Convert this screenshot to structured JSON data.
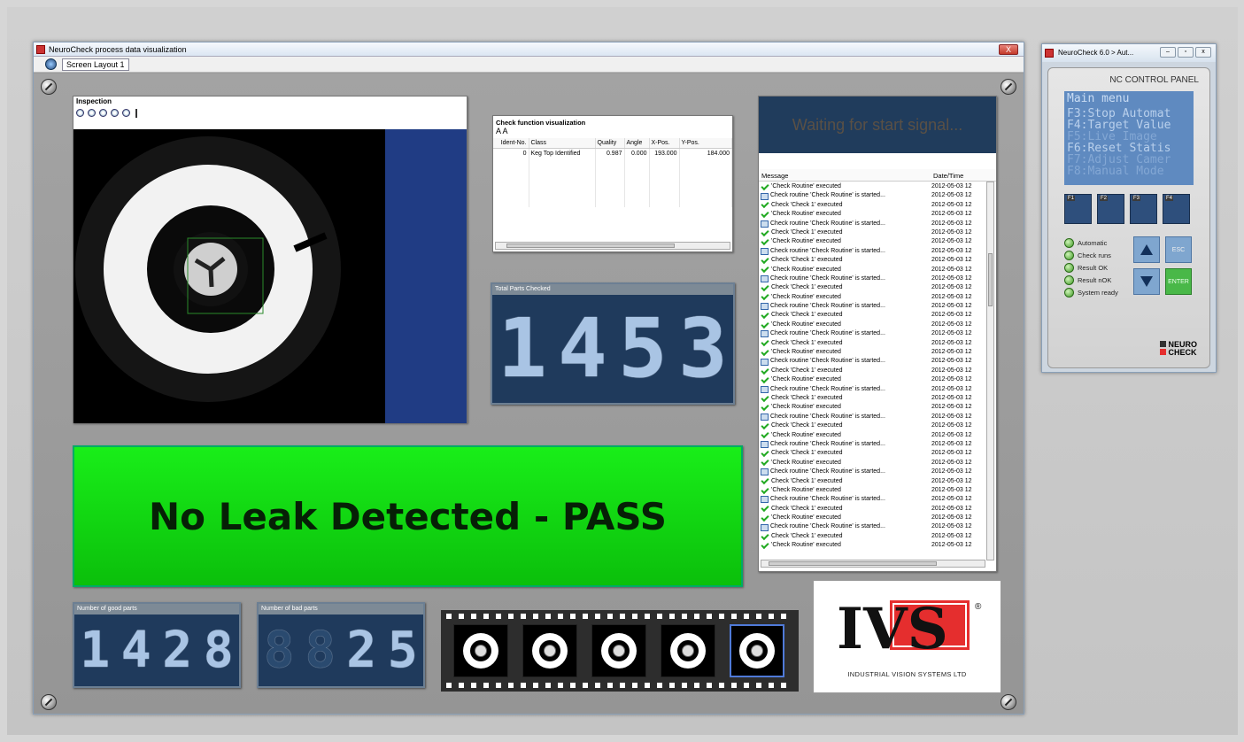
{
  "window": {
    "title": "NeuroCheck process data visualization",
    "close_label": "X"
  },
  "toolbar": {
    "layout_label": "Screen Layout 1"
  },
  "inspection": {
    "title": "Inspection"
  },
  "check_function": {
    "title": "Check function visualization",
    "font_controls": "A A",
    "columns": [
      "Ident-No.",
      "Class",
      "Quality",
      "Angle",
      "X-Pos.",
      "Y-Pos."
    ],
    "rows": [
      [
        "0",
        "Keg Top Identified",
        "0.987",
        "0.000",
        "193.000",
        "184.000"
      ]
    ]
  },
  "total_parts": {
    "label": "Total Parts Checked",
    "digits": [
      "1",
      "4",
      "5",
      "3"
    ]
  },
  "good_parts": {
    "label": "Number of good parts",
    "digits": [
      "1",
      "4",
      "2",
      "8"
    ]
  },
  "bad_parts": {
    "label": "Number of bad parts",
    "digits": [
      "8",
      "8",
      "2",
      "5"
    ],
    "lit": [
      false,
      false,
      true,
      true
    ]
  },
  "status": {
    "waiting_text": "Waiting for start signal...",
    "result_text": "No Leak Detected - PASS"
  },
  "messages": {
    "col_message": "Message",
    "col_datetime": "Date/Time",
    "date": "2012-05-03 12",
    "items": [
      {
        "type": "ok",
        "text": "'Check Routine' executed"
      },
      {
        "type": "cr",
        "text": "Check routine 'Check Routine' is started..."
      },
      {
        "type": "ok",
        "text": "Check 'Check 1' executed"
      },
      {
        "type": "ok",
        "text": "'Check Routine' executed"
      },
      {
        "type": "cr",
        "text": "Check routine 'Check Routine' is started..."
      },
      {
        "type": "ok",
        "text": "Check 'Check 1' executed"
      },
      {
        "type": "ok",
        "text": "'Check Routine' executed"
      },
      {
        "type": "cr",
        "text": "Check routine 'Check Routine' is started..."
      },
      {
        "type": "ok",
        "text": "Check 'Check 1' executed"
      },
      {
        "type": "ok",
        "text": "'Check Routine' executed"
      },
      {
        "type": "cr",
        "text": "Check routine 'Check Routine' is started..."
      },
      {
        "type": "ok",
        "text": "Check 'Check 1' executed"
      },
      {
        "type": "ok",
        "text": "'Check Routine' executed"
      },
      {
        "type": "cr",
        "text": "Check routine 'Check Routine' is started..."
      },
      {
        "type": "ok",
        "text": "Check 'Check 1' executed"
      },
      {
        "type": "ok",
        "text": "'Check Routine' executed"
      },
      {
        "type": "cr",
        "text": "Check routine 'Check Routine' is started..."
      },
      {
        "type": "ok",
        "text": "Check 'Check 1' executed"
      },
      {
        "type": "ok",
        "text": "'Check Routine' executed"
      },
      {
        "type": "cr",
        "text": "Check routine 'Check Routine' is started..."
      },
      {
        "type": "ok",
        "text": "Check 'Check 1' executed"
      },
      {
        "type": "ok",
        "text": "'Check Routine' executed"
      },
      {
        "type": "cr",
        "text": "Check routine 'Check Routine' is started..."
      },
      {
        "type": "ok",
        "text": "Check 'Check 1' executed"
      },
      {
        "type": "ok",
        "text": "'Check Routine' executed"
      },
      {
        "type": "cr",
        "text": "Check routine 'Check Routine' is started..."
      },
      {
        "type": "ok",
        "text": "Check 'Check 1' executed"
      },
      {
        "type": "ok",
        "text": "'Check Routine' executed"
      },
      {
        "type": "cr",
        "text": "Check routine 'Check Routine' is started..."
      },
      {
        "type": "ok",
        "text": "Check 'Check 1' executed"
      },
      {
        "type": "ok",
        "text": "'Check Routine' executed"
      },
      {
        "type": "cr",
        "text": "Check routine 'Check Routine' is started..."
      },
      {
        "type": "ok",
        "text": "Check 'Check 1' executed"
      },
      {
        "type": "ok",
        "text": "'Check Routine' executed"
      },
      {
        "type": "cr",
        "text": "Check routine 'Check Routine' is started..."
      },
      {
        "type": "ok",
        "text": "Check 'Check 1' executed"
      },
      {
        "type": "ok",
        "text": "'Check Routine' executed"
      },
      {
        "type": "cr",
        "text": "Check routine 'Check Routine' is started..."
      },
      {
        "type": "ok",
        "text": "Check 'Check 1' executed"
      },
      {
        "type": "ok",
        "text": "'Check Routine' executed"
      }
    ]
  },
  "logo": {
    "mark": "IVS",
    "tagline": "INDUSTRIAL VISION SYSTEMS LTD",
    "registered": "®"
  },
  "nc_panel": {
    "window_title": "NeuroCheck 6.0 > Aut...",
    "title": "NC CONTROL PANEL",
    "lcd_title": "Main menu",
    "lcd_lines": [
      {
        "text": "F3:Stop Automat",
        "dim": false
      },
      {
        "text": "F4:Target Value",
        "dim": false
      },
      {
        "text": "F5:Live Image",
        "dim": true
      },
      {
        "text": "F6:Reset Statis",
        "dim": false
      },
      {
        "text": "F7:Adjust Camer",
        "dim": true
      },
      {
        "text": "F8:Manual Mode",
        "dim": true
      }
    ],
    "fkeys": [
      "F1",
      "F2",
      "F3",
      "F4"
    ],
    "leds": [
      "Automatic",
      "Check runs",
      "Result OK",
      "Result nOK",
      "System ready"
    ],
    "esc_label": "ESC",
    "enter_label": "ENTER",
    "brand_line1": "NEURO",
    "brand_line2": "CHECK"
  },
  "colors": {
    "pass_green": "#19ee19",
    "panel_blue": "#1f3a5c",
    "accent_red": "#e52e2e"
  }
}
